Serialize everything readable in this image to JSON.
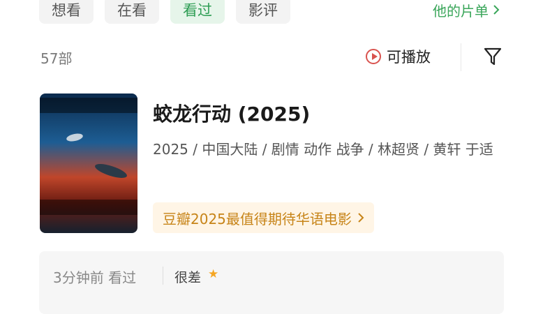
{
  "tabs": [
    {
      "label": "想看"
    },
    {
      "label": "在看"
    },
    {
      "label": "看过"
    },
    {
      "label": "影评"
    }
  ],
  "active_tab_index": 2,
  "his_list_label": "他的片单",
  "count_label": "57部",
  "playable_label": "可播放",
  "movie": {
    "title": "蛟龙行动 (2025)",
    "meta": "2025 / 中国大陆 / 剧情 动作 战争 / 林超贤 / 黄轩 于适",
    "rank_badge": "豆瓣2025最值得期待华语电影"
  },
  "review": {
    "time": "3分钟前 看过",
    "rating_label": "很差",
    "stars": 1
  },
  "colors": {
    "accent_green": "#2f9e55",
    "play_red": "#d9534f",
    "badge_gold": "#c78418",
    "star": "#f5a623"
  }
}
